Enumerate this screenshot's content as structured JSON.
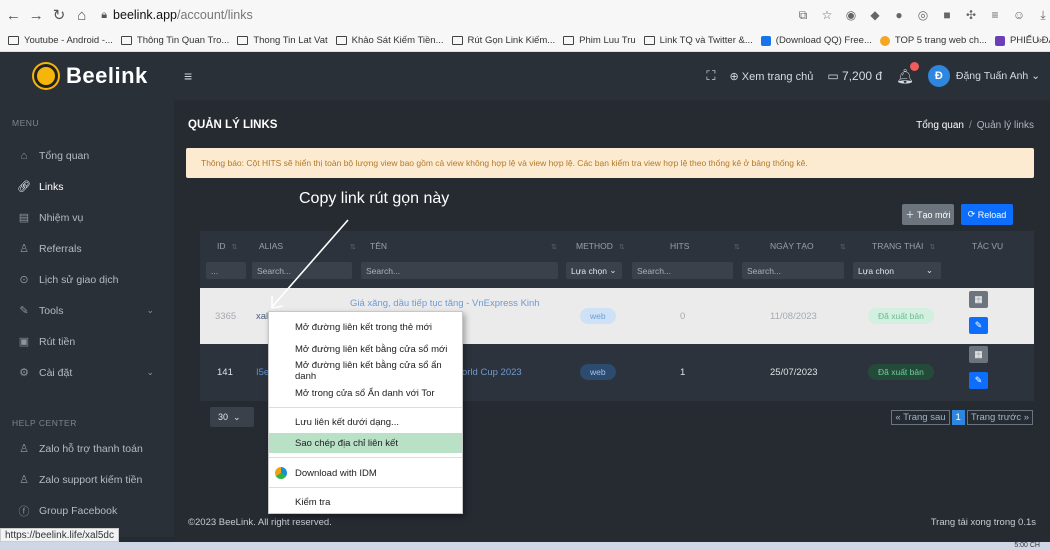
{
  "browser": {
    "url_host": "beelink.app",
    "url_path": "/account/links",
    "bookmarks": [
      "Youtube - Android -...",
      "Thông Tin Quan Tro...",
      "Thong Tin Lat Vat",
      "Khảo Sát Kiếm Tiền...",
      "Rút Gọn Link Kiếm...",
      "Phim Luu Tru",
      "Link TQ và Twitter &...",
      "(Download QQ) Free...",
      "TOP 5 trang web ch...",
      "PHIẾU ĐĂNG KÝ TH..."
    ],
    "more": "»"
  },
  "brand": {
    "name": "Beelink"
  },
  "sidebar": {
    "menu_title": "MENU",
    "items": [
      {
        "label": "Tổng quan",
        "icon": "home-icon"
      },
      {
        "label": "Links",
        "icon": "link-icon"
      },
      {
        "label": "Nhiệm vụ",
        "icon": "task-icon"
      },
      {
        "label": "Referrals",
        "icon": "user-plus-icon"
      },
      {
        "label": "Lịch sử giao dịch",
        "icon": "history-icon"
      },
      {
        "label": "Tools",
        "icon": "tools-icon"
      },
      {
        "label": "Rút tiền",
        "icon": "wallet-icon"
      },
      {
        "label": "Cài đặt",
        "icon": "settings-icon"
      }
    ],
    "help_title": "HELP CENTER",
    "help_items": [
      {
        "label": "Zalo hỗ trợ thanh toán",
        "icon": "user-icon"
      },
      {
        "label": "Zalo support kiếm tiền",
        "icon": "user-icon"
      },
      {
        "label": "Group Facebook",
        "icon": "facebook-icon"
      }
    ]
  },
  "topbar": {
    "view_site": "Xem trang chủ",
    "balance": "7,200 đ",
    "avatar_letter": "Đ",
    "user_name": "Đặng Tuấn Anh"
  },
  "page": {
    "title": "QUẢN LÝ LINKS",
    "breadcrumb_home": "Tổng quan",
    "breadcrumb_sep": "/",
    "breadcrumb_current": "Quản lý links",
    "notice": "Thông báo: Cột HITS sẽ hiển thị toàn bộ lượng view bao gồm cả view không hợp lệ và view hợp lệ. Các bạn kiểm tra view hợp lệ theo thống kê ở bảng thống kê.",
    "annotation": "Copy link rút gọn này",
    "create_label": "Tạo mới",
    "reload_label": "Reload"
  },
  "table": {
    "headers": {
      "id": "ID",
      "alias": "ALIAS",
      "name": "TÊN",
      "method": "METHOD",
      "hits": "HITS",
      "date": "NGÀY TẠO",
      "status": "TRẠNG THÁI",
      "action": "TÁC VỤ"
    },
    "filters": {
      "id": "...",
      "alias": "Search...",
      "name": "Search...",
      "method": "Lựa chọn",
      "hits": "Search...",
      "date": "Search...",
      "status": "Lựa chọn"
    },
    "rows": [
      {
        "id": "3365",
        "alias": "xal5dc",
        "name": "Giá xăng, dầu tiếp tục tăng - VnExpress Kinh",
        "method": "web",
        "hits": "0",
        "date": "11/08/2023",
        "status": "Đã xuất bản"
      },
      {
        "id": "141",
        "alias": "I5e",
        "name": "orld Cup 2023",
        "method": "web",
        "hits": "1",
        "date": "25/07/2023",
        "status": "Đã xuất bản"
      }
    ],
    "per_page": "30",
    "pager_prev": "« Trang sau",
    "pager_current": "1",
    "pager_next": "Trang trước »"
  },
  "footer": {
    "copyright": "©2023 BeeLink. All right reserved.",
    "load_time": "Trang tải xong trong 0.1s"
  },
  "status_url": "https://beelink.life/xal5dc",
  "context_menu": [
    "Mở đường liên kết trong thẻ mới",
    "Mở đường liên kết bằng cửa sổ mới",
    "Mở đường liên kết bằng cửa sổ ẩn danh",
    "Mở trong cửa sổ Ẩn danh với Tor",
    "Lưu liên kết dưới dạng...",
    "Sao chép địa chỉ liên kết",
    "Download with IDM",
    "Kiểm tra"
  ],
  "taskbar_clock": "5:00 CH"
}
